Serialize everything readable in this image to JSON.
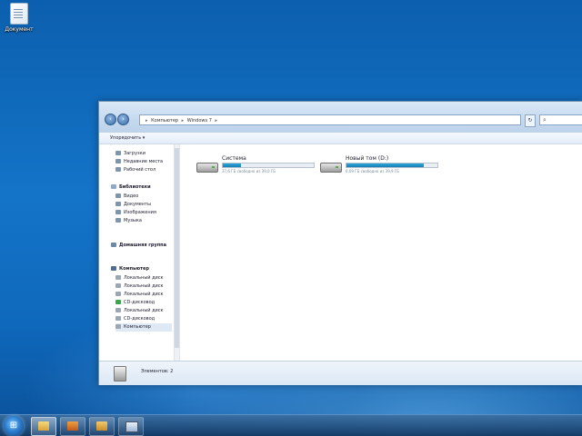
{
  "desktop": {
    "icon_label": "Документ"
  },
  "window": {
    "address": {
      "segments": [
        "Компьютер",
        "Windows 7"
      ]
    },
    "toolbar": {
      "organize_label": "Упорядочить ▾"
    },
    "nav": {
      "favorites": [
        "Загрузки",
        "Недавние места",
        "Рабочий стол"
      ],
      "libraries_header": "Библиотеки",
      "libraries": [
        "Видео",
        "Документы",
        "Изображения",
        "Музыка"
      ],
      "homegroup": "Домашняя группа",
      "computer_header": "Компьютер",
      "drives": [
        "Локальный диск",
        "Локальный диск",
        "Локальный диск",
        "CD-дисковод",
        "Локальный диск",
        "CD-дисковод",
        "Компьютер"
      ]
    },
    "drives": [
      {
        "name": "Система",
        "free_text": "37,6 ГБ свободно из 39,0 ГБ",
        "used_fraction": 0.2
      },
      {
        "name": "Новый том (D:)",
        "free_text": "6,09 ГБ свободно из 39,9 ГБ",
        "used_fraction": 0.85
      }
    ],
    "details": {
      "text": "Элементов: 2"
    }
  },
  "taskbar": {
    "start_glyph": "⊞",
    "buttons": [
      "explorer",
      "media-player",
      "folder",
      "window"
    ]
  },
  "icons": {
    "back": "back-arrow-icon",
    "forward": "forward-arrow-icon",
    "search": "search-icon",
    "refresh": "refresh-icon"
  },
  "colors": {
    "desktop": "#1474c8",
    "drive_bar": "#1a7fb5"
  }
}
